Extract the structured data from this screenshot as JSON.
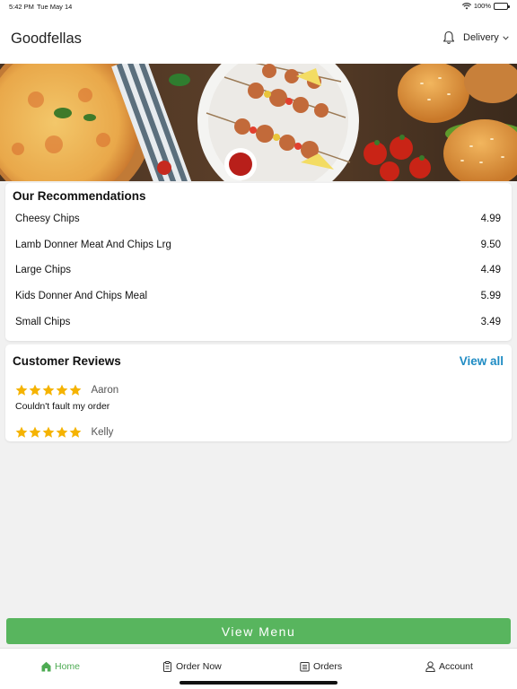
{
  "status_bar": {
    "time": "5:42 PM",
    "date": "Tue May 14",
    "battery": "100%"
  },
  "header": {
    "title": "Goodfellas",
    "delivery_label": "Delivery"
  },
  "recommendations": {
    "title": "Our Recommendations",
    "items": [
      {
        "name": "Cheesy Chips",
        "price": "4.99"
      },
      {
        "name": "Lamb Donner Meat And Chips Lrg",
        "price": "9.50"
      },
      {
        "name": "Large Chips",
        "price": "4.49"
      },
      {
        "name": "Kids Donner And Chips Meal",
        "price": "5.99"
      },
      {
        "name": "Small Chips",
        "price": "3.49"
      }
    ]
  },
  "reviews": {
    "title": "Customer Reviews",
    "view_all": "View all",
    "items": [
      {
        "name": "Aaron",
        "rating": 5,
        "text": "Couldn't fault my order"
      },
      {
        "name": "Kelly",
        "rating": 5,
        "text": ""
      }
    ]
  },
  "view_menu_label": "View Menu",
  "tabs": [
    {
      "label": "Home",
      "icon": "home-icon",
      "active": true
    },
    {
      "label": "Order Now",
      "icon": "order-icon",
      "active": false
    },
    {
      "label": "Orders",
      "icon": "orders-list-icon",
      "active": false
    },
    {
      "label": "Account",
      "icon": "account-icon",
      "active": false
    }
  ],
  "colors": {
    "accent_green": "#58b55e",
    "link_blue": "#1e8bc3",
    "star": "#f5b301"
  }
}
